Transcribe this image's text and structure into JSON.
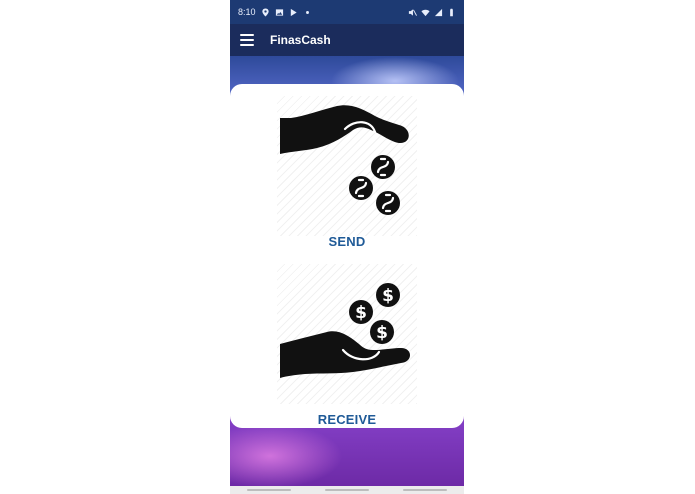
{
  "status_bar": {
    "time": "8:10",
    "left_icons": [
      "location-icon",
      "image-icon",
      "play-store-icon",
      "dot-icon"
    ],
    "right_icons": [
      "mute-icon",
      "wifi-icon",
      "signal-icon",
      "battery-icon"
    ]
  },
  "app_bar": {
    "title": "FinasCash",
    "menu_icon": "hamburger-menu-icon"
  },
  "actions": {
    "send": {
      "label": "SEND",
      "icon": "hand-giving-coins-icon"
    },
    "receive": {
      "label": "RECEIVE",
      "icon": "hand-receiving-coins-icon"
    }
  },
  "colors": {
    "status_bar": "#1d3a73",
    "app_bar": "#1b2c5c",
    "label": "#1f5a97"
  }
}
